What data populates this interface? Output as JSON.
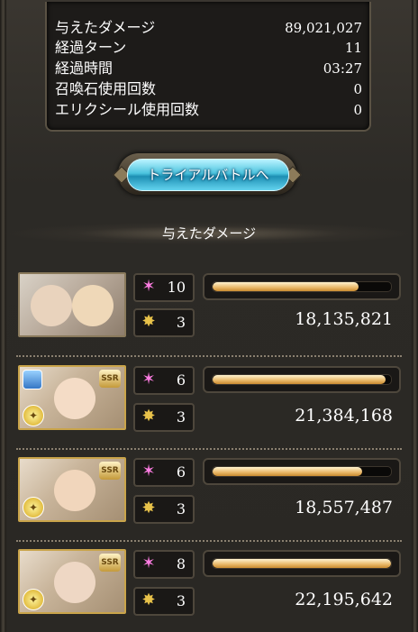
{
  "summary": [
    {
      "label": "与えたダメージ",
      "value": "89,021,027"
    },
    {
      "label": "経過ターン",
      "value": "11"
    },
    {
      "label": "経過時間",
      "value": "03:27"
    },
    {
      "label": "召喚石使用回数",
      "value": "0"
    },
    {
      "label": "エリクシール使用回数",
      "value": "0"
    }
  ],
  "button_label": "トライアルバトルへ",
  "section_title": "与えたダメージ",
  "members": [
    {
      "charge_attacks": "10",
      "skills": "3",
      "damage": "18,135,821",
      "damage_share": 0.82,
      "rarity": ""
    },
    {
      "charge_attacks": "6",
      "skills": "3",
      "damage": "21,384,168",
      "damage_share": 0.97,
      "rarity": "SSR"
    },
    {
      "charge_attacks": "6",
      "skills": "3",
      "damage": "18,557,487",
      "damage_share": 0.84,
      "rarity": "SSR"
    },
    {
      "charge_attacks": "8",
      "skills": "3",
      "damage": "22,195,642",
      "damage_share": 1.0,
      "rarity": "SSR"
    }
  ],
  "icons": {
    "charge": "pink-sparkle-icon",
    "skill": "gold-burst-icon"
  },
  "colors": {
    "accent_blue": "#4bc3de",
    "bar_gold": "#e9b767",
    "charge_pink": "#ff7de3"
  }
}
